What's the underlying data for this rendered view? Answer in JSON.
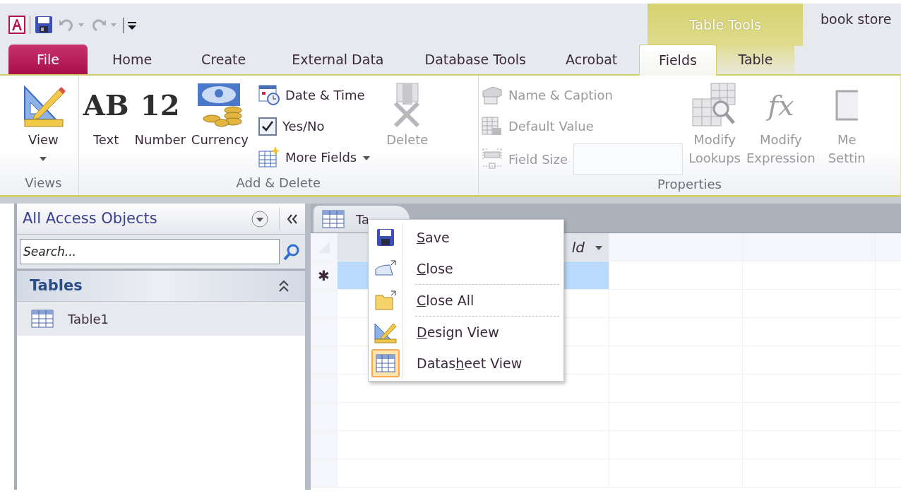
{
  "window": {
    "title": "book store",
    "contextual_group": "Table Tools"
  },
  "tabs": [
    {
      "label": "File",
      "kind": "file",
      "selected": false
    },
    {
      "label": "Home",
      "kind": "normal",
      "selected": false
    },
    {
      "label": "Create",
      "kind": "normal",
      "selected": false
    },
    {
      "label": "External Data",
      "kind": "normal",
      "selected": false
    },
    {
      "label": "Database Tools",
      "kind": "normal",
      "selected": false
    },
    {
      "label": "Acrobat",
      "kind": "normal",
      "selected": false
    },
    {
      "label": "Fields",
      "kind": "contextual",
      "selected": true
    },
    {
      "label": "Table",
      "kind": "contextual",
      "selected": false
    }
  ],
  "ribbon": {
    "groups": [
      {
        "label": "Views",
        "items": [
          {
            "kind": "large",
            "lines": [
              "View"
            ],
            "dropdown": true,
            "disabled": false
          }
        ]
      },
      {
        "label": "Add & Delete",
        "items": [
          {
            "kind": "large",
            "glyph": "AB",
            "lines": [
              "Text"
            ],
            "disabled": false
          },
          {
            "kind": "large",
            "glyph": "12",
            "lines": [
              "Number"
            ],
            "disabled": false
          },
          {
            "kind": "large",
            "lines": [
              "Currency"
            ],
            "disabled": false
          },
          {
            "kind": "stack",
            "items": [
              {
                "label": "Date & Time",
                "disabled": false
              },
              {
                "label": "Yes/No",
                "disabled": false
              },
              {
                "label": "More Fields",
                "dropdown": true,
                "disabled": false
              }
            ]
          },
          {
            "kind": "large",
            "lines": [
              "Delete"
            ],
            "disabled": true
          }
        ]
      },
      {
        "label": "Properties",
        "items": [
          {
            "kind": "stack",
            "items": [
              {
                "label": "Name & Caption",
                "disabled": true
              },
              {
                "label": "Default Value",
                "disabled": true
              },
              {
                "label": "Field Size",
                "field": true,
                "disabled": true
              }
            ]
          },
          {
            "kind": "large",
            "lines": [
              "Modify",
              "Lookups"
            ],
            "disabled": true
          },
          {
            "kind": "large",
            "glyph": "fx",
            "lines": [
              "Modify",
              "Expression"
            ],
            "disabled": true
          },
          {
            "kind": "large",
            "lines": [
              "Me",
              "Settin"
            ],
            "disabled": true
          }
        ]
      }
    ]
  },
  "nav_pane": {
    "title": "All Access Objects",
    "search": {
      "placeholder": "Search..."
    },
    "groups": [
      {
        "label": "Tables",
        "expanded": true,
        "items": [
          {
            "label": "Table1",
            "selected": true
          }
        ]
      }
    ]
  },
  "document_tabs": [
    {
      "label": "Ta",
      "selected": true
    }
  ],
  "datasheet": {
    "columns": [
      {
        "label": "ld",
        "selected": true
      },
      {
        "selected": false
      },
      {
        "selected": false
      }
    ],
    "new_row_marker": "✱"
  },
  "context_menu": [
    {
      "key": "S",
      "after": "ave",
      "checked": false,
      "separator_after": false
    },
    {
      "key": "C",
      "after": "lose",
      "checked": false,
      "separator_after": true
    },
    {
      "key": "C",
      "after": "lose All",
      "checked": false,
      "separator_after": true
    },
    {
      "key": "D",
      "after": "esign View",
      "checked": false,
      "separator_after": false
    },
    {
      "before": "Datas",
      "key": "h",
      "after": "eet View",
      "checked": true,
      "separator_after": false
    }
  ]
}
